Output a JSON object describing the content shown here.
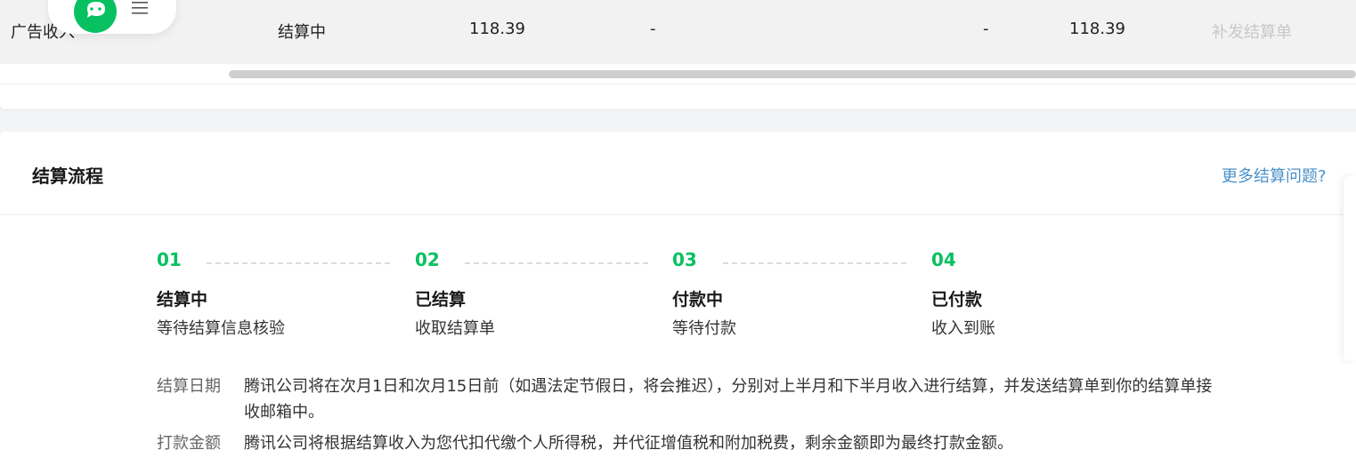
{
  "income_table": {
    "row": {
      "type": "广告收入",
      "status": "结算中",
      "amount": "118.39",
      "col4": "-",
      "col5": "-",
      "final_amount": "118.39",
      "action": "补发结算单"
    }
  },
  "process": {
    "title": "结算流程",
    "more_link": "更多结算问题?",
    "steps": [
      {
        "num": "01",
        "title": "结算中",
        "desc": "等待结算信息核验"
      },
      {
        "num": "02",
        "title": "已结算",
        "desc": "收取结算单"
      },
      {
        "num": "03",
        "title": "付款中",
        "desc": "等待付款"
      },
      {
        "num": "04",
        "title": "已付款",
        "desc": "收入到账"
      }
    ],
    "notes": [
      {
        "label": "结算日期",
        "text": "腾讯公司将在次月1日和次月15日前（如遇法定节假日，将会推迟），分别对上半月和下半月收入进行结算，并发送结算单到你的结算单接收邮箱中。"
      },
      {
        "label": "打款金额",
        "text": "腾讯公司将根据结算收入为您代扣代缴个人所得税，并代征增值税和附加税费，剩余金额即为最终打款金额。"
      }
    ]
  },
  "colors": {
    "accent_green": "#07c160",
    "link_blue": "#4a90c8",
    "disabled_gray": "#c8c8c8"
  },
  "icons": {
    "chat": "wechat-chat-icon",
    "menu": "menu-icon"
  }
}
